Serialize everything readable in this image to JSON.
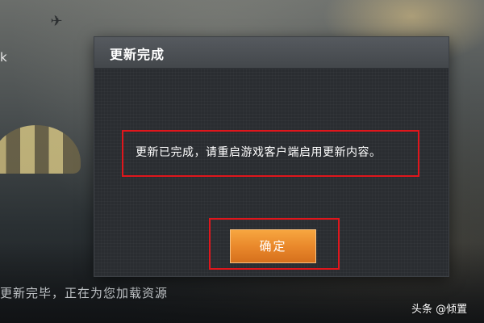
{
  "dialog": {
    "title": "更新完成",
    "message": "更新已完成，请重启游戏客户端启用更新内容。",
    "confirm_label": "确定"
  },
  "background": {
    "status_text": "更新完毕，正在为您加载资源",
    "edge_char": "k"
  },
  "watermark": "头条 @倾置",
  "colors": {
    "highlight_border": "#e0161c",
    "confirm_button": "#e8862a",
    "dialog_bg": "#2a2d31"
  }
}
